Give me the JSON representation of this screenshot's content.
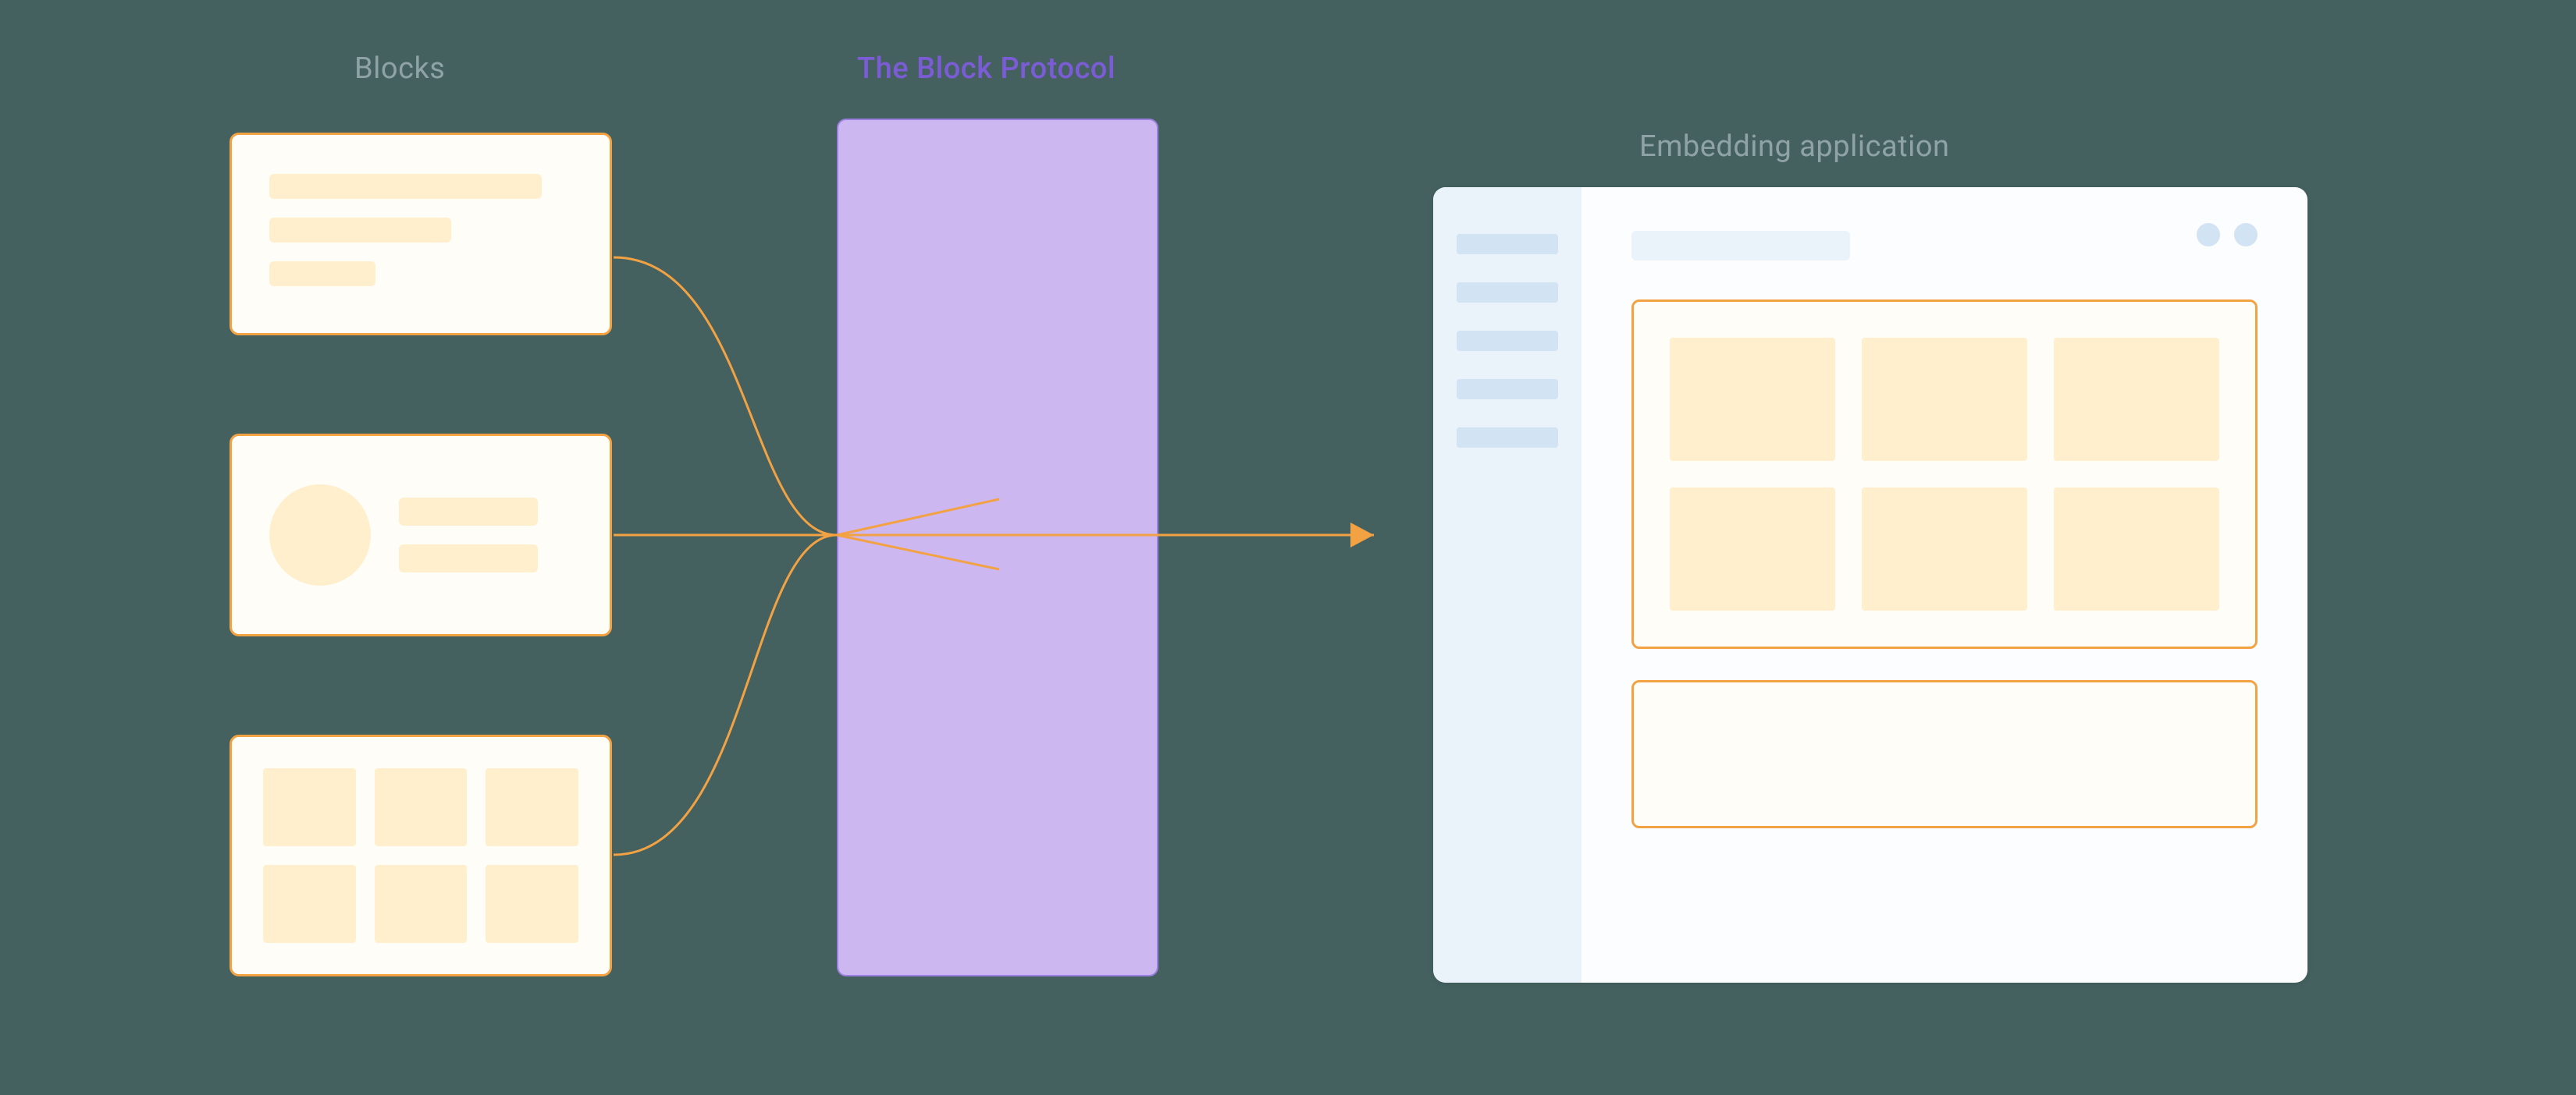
{
  "labels": {
    "blocks": "Blocks",
    "protocol": "The Block Protocol",
    "app": "Embedding application"
  },
  "colors": {
    "background": "#44615F",
    "block_border": "#F3A243",
    "block_fill": "#FFFDF8",
    "block_content": "#FFEFCC",
    "protocol_fill": "#CDB7F0",
    "protocol_border": "#9B7FE0",
    "protocol_label": "#7B5CD6",
    "app_fill": "#FCFDFE",
    "app_sidebar": "#EAF2FA",
    "app_sidebar_item": "#D2E3F3",
    "muted_text": "#8FA3A6",
    "connector": "#F3A243"
  },
  "diagram": {
    "blocks": [
      {
        "kind": "text-lines",
        "lines": 3
      },
      {
        "kind": "avatar-with-lines",
        "lines": 2
      },
      {
        "kind": "grid",
        "rows": 2,
        "cols": 3
      }
    ],
    "app_window": {
      "sidebar_items": 5,
      "window_dots": 2,
      "embeds": [
        {
          "kind": "grid",
          "rows": 2,
          "cols": 3
        },
        {
          "kind": "empty"
        }
      ]
    },
    "flow": "blocks -> protocol -> app"
  }
}
